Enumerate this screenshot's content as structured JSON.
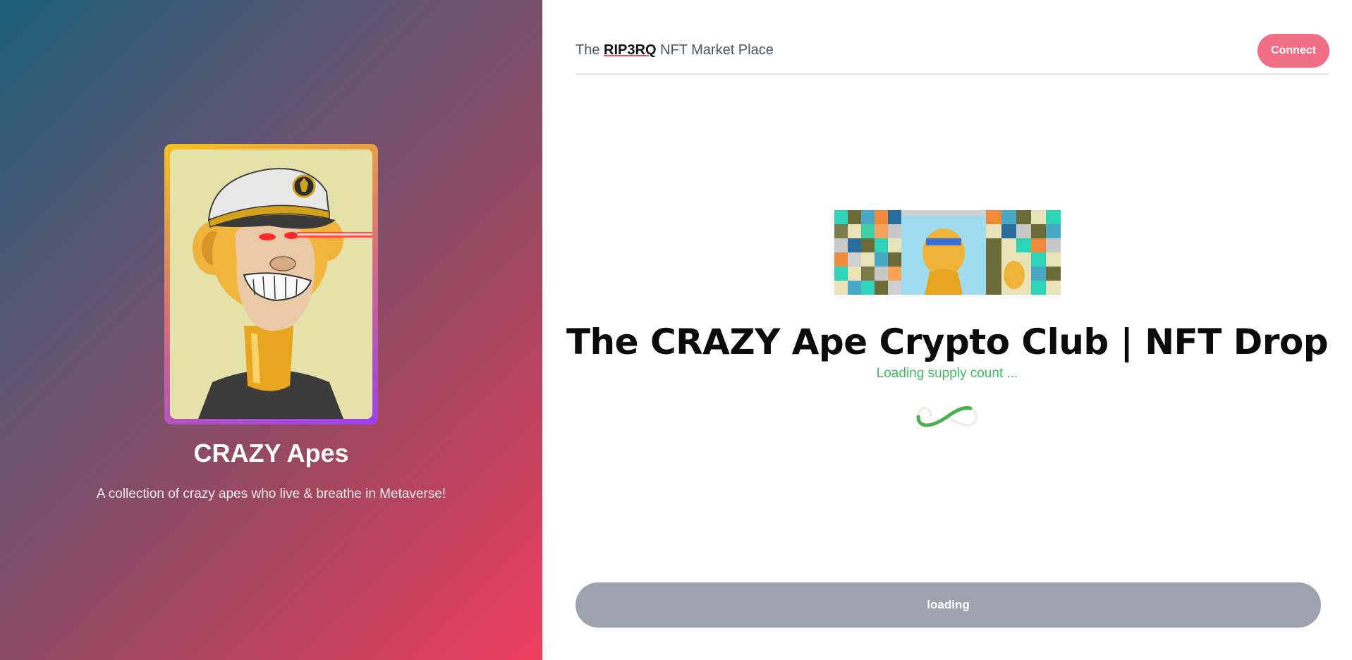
{
  "collection": {
    "title": "CRAZY Apes",
    "description": "A collection of crazy apes who live & breathe in Metaverse!"
  },
  "header": {
    "brand_prefix": "The ",
    "brand_mark": "RIP3RQ",
    "brand_suffix": " NFT Market Place",
    "connect_label": "Connect"
  },
  "drop": {
    "title": "The CRAZY Ape Crypto Club | NFT Drop",
    "supply_status": "Loading supply count ...",
    "loader_icon": "infinity-spinner-icon",
    "button_label": "loading"
  },
  "colors": {
    "accent": "#f06f86",
    "loading_text": "#3dbb63",
    "disabled_button": "#9ca3af"
  }
}
